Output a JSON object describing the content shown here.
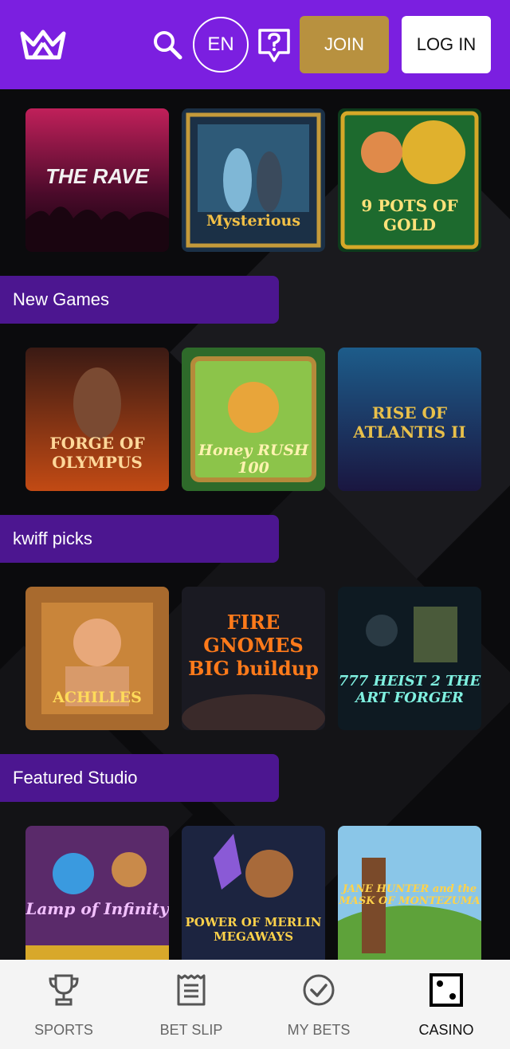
{
  "header": {
    "lang_label": "EN",
    "join_label": "JOIN",
    "login_label": "LOG IN",
    "brand_color": "#7b1fe0",
    "join_color": "#b8913f"
  },
  "rows": [
    {
      "section_title": "",
      "games": [
        {
          "title": "THE RAVE"
        },
        {
          "title": "Mysterious"
        },
        {
          "title": "9 POTS OF GOLD"
        }
      ]
    },
    {
      "section_title": "New Games",
      "games": [
        {
          "title": "FORGE OF OLYMPUS"
        },
        {
          "title": "Honey RUSH 100"
        },
        {
          "title": "RISE OF ATLANTIS II"
        }
      ]
    },
    {
      "section_title": "kwiff picks",
      "games": [
        {
          "title": "ACHILLES"
        },
        {
          "title": "FIRE GNOMES BIG buildup"
        },
        {
          "title": "777 HEIST 2 THE ART FORGER"
        }
      ]
    },
    {
      "section_title": "Featured Studio",
      "games": [
        {
          "title": "Lamp of Infinity"
        },
        {
          "title": "POWER OF MERLIN MEGAWAYS"
        },
        {
          "title": "JANE HUNTER and the MASK OF MONTEZUMA"
        }
      ]
    }
  ],
  "bottom_nav": [
    {
      "label": "SPORTS",
      "icon": "trophy-icon"
    },
    {
      "label": "BET SLIP",
      "icon": "receipt-icon"
    },
    {
      "label": "MY BETS",
      "icon": "check-circle-icon"
    },
    {
      "label": "CASINO",
      "icon": "dice-icon",
      "active": true
    }
  ]
}
